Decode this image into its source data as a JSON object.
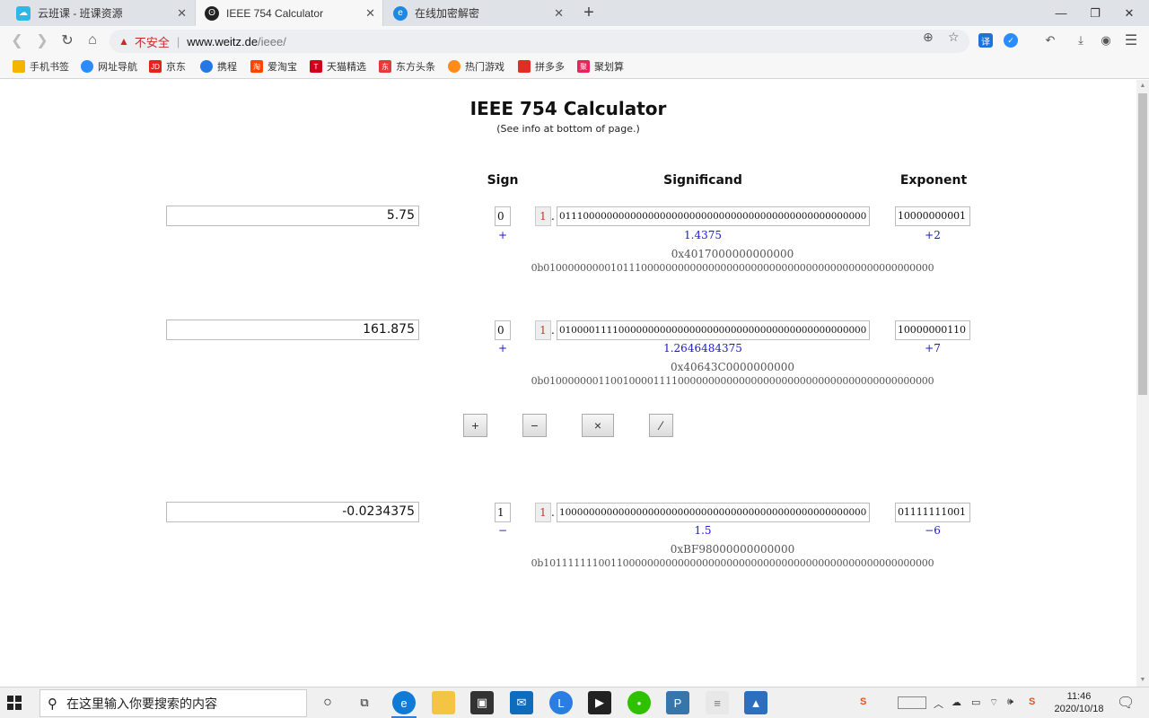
{
  "browser": {
    "tabs": [
      {
        "title": "云班课 - 班课资源",
        "icon": "cloud-class-icon",
        "active": false
      },
      {
        "title": "IEEE 754 Calculator",
        "icon": "bear-icon",
        "active": true
      },
      {
        "title": "在线加密解密",
        "icon": "globe-icon",
        "active": false
      }
    ],
    "new_tab_label": "+",
    "security_label": "不安全",
    "url_host": "www.weitz.de",
    "url_path": "/ieee/",
    "bookmarks": [
      {
        "label": "手机书签",
        "icon": "phone-bookmark-icon",
        "color": "#f4b400"
      },
      {
        "label": "网址导航",
        "icon": "nav-icon",
        "color": "#2a8cff"
      },
      {
        "label": "京东",
        "icon": "jd-icon",
        "color": "#e1251b"
      },
      {
        "label": "携程",
        "icon": "ctrip-icon",
        "color": "#2577e3"
      },
      {
        "label": "爱淘宝",
        "icon": "aitaobao-icon",
        "color": "#ff4400"
      },
      {
        "label": "天猫精选",
        "icon": "tmall-icon",
        "color": "#d0021b"
      },
      {
        "label": "东方头条",
        "icon": "dftt-icon",
        "color": "#e23b3b"
      },
      {
        "label": "热门游戏",
        "icon": "game-icon",
        "color": "#ff8c1a"
      },
      {
        "label": "拼多多",
        "icon": "pdd-icon",
        "color": "#e02e24"
      },
      {
        "label": "聚划算",
        "icon": "juhuasuan-icon",
        "color": "#e8245a"
      }
    ]
  },
  "page": {
    "title": "IEEE 754 Calculator",
    "subtitle": "(See info at bottom of page.)",
    "headers": {
      "sign": "Sign",
      "significand": "Significand",
      "exponent": "Exponent"
    },
    "rows": [
      {
        "decimal": "5.75",
        "sign_bit": "0",
        "sign_symbol": "+",
        "implicit_bit": "1",
        "dot": ".",
        "mantissa": "0111000000000000000000000000000000000000000000000000",
        "significand_value": "1.4375",
        "exponent_bits": "10000000001",
        "exponent_value": "+2",
        "hex": "0x4017000000000000",
        "binary": "0b0100000000010111000000000000000000000000000000000000000000000000"
      },
      {
        "decimal": "161.875",
        "sign_bit": "0",
        "sign_symbol": "+",
        "implicit_bit": "1",
        "dot": ".",
        "mantissa": "0100001111000000000000000000000000000000000000000000",
        "significand_value": "1.2646484375",
        "exponent_bits": "10000000110",
        "exponent_value": "+7",
        "hex": "0x40643C0000000000",
        "binary": "0b0100000001100100001111000000000000000000000000000000000000000000"
      },
      {
        "decimal": "-0.0234375",
        "sign_bit": "1",
        "sign_symbol": "−",
        "implicit_bit": "1",
        "dot": ".",
        "mantissa": "1000000000000000000000000000000000000000000000000000",
        "significand_value": "1.5",
        "exponent_bits": "01111111001",
        "exponent_value": "−6",
        "hex": "0xBF98000000000000",
        "binary": "0b1011111110011000000000000000000000000000000000000000000000000000"
      }
    ],
    "operations": [
      "+",
      "−",
      "×",
      "∕"
    ]
  },
  "taskbar": {
    "search_placeholder": "在这里输入你要搜索的内容",
    "time": "11:46",
    "date": "2020/10/18",
    "apps": [
      "cortana-icon",
      "task-view-icon",
      "edge-icon",
      "file-explorer-icon",
      "store-icon",
      "mail-icon",
      "app-l-icon",
      "media-icon",
      "wechat-icon",
      "python-icon",
      "notepad-icon",
      "photos-icon"
    ]
  }
}
